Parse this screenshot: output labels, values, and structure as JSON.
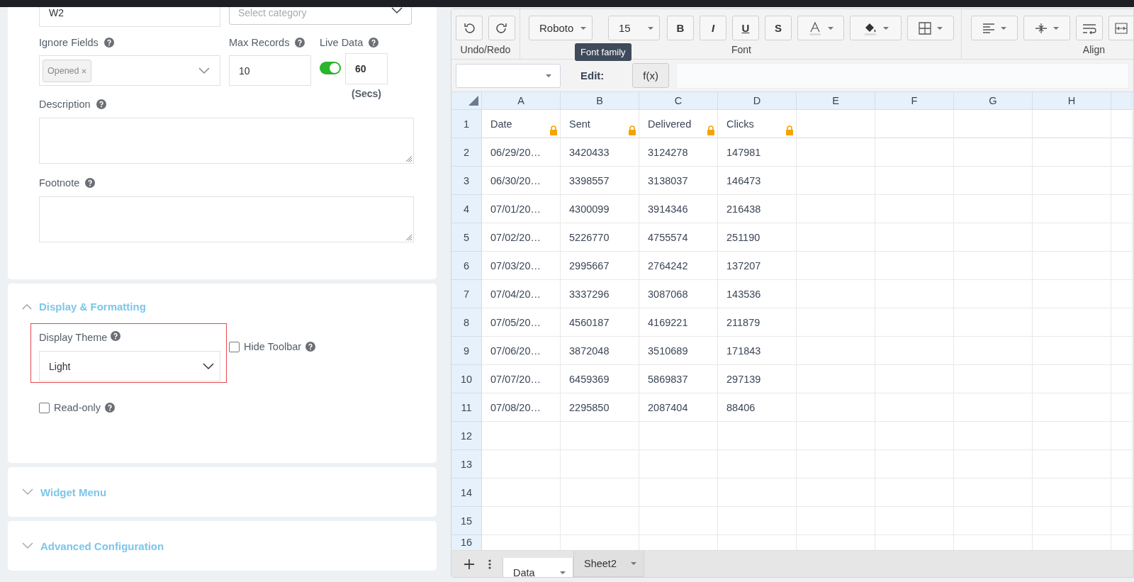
{
  "form": {
    "name_value": "W2",
    "category_placeholder": "Select category",
    "ignore_fields": {
      "label": "Ignore Fields",
      "tags": [
        "Opened"
      ]
    },
    "max_records": {
      "label": "Max Records",
      "value": "10"
    },
    "live_data": {
      "label": "Live Data",
      "on": true,
      "interval": "60",
      "unit": "(Secs)"
    },
    "description": {
      "label": "Description"
    },
    "footnote": {
      "label": "Footnote"
    }
  },
  "sections": [
    {
      "title": "Display & Formatting",
      "expanded": true,
      "theme": {
        "label": "Display Theme",
        "value": "Light",
        "highlighted": true
      },
      "options": [
        {
          "label": "Hide Toolbar",
          "checked": false
        },
        {
          "label": "Read-only",
          "checked": false
        }
      ]
    },
    {
      "title": "Widget Menu",
      "expanded": false
    },
    {
      "title": "Advanced Configuration",
      "expanded": false
    }
  ],
  "sheet": {
    "toolbar": {
      "undo_label": "Undo/Redo",
      "font_label": "Font",
      "align_label": "Align",
      "font_family": "Roboto",
      "font_size": "15",
      "styles": [
        "B",
        "I",
        "U",
        "S"
      ],
      "tooltip": "Font family"
    },
    "formula": {
      "label": "Edit:",
      "fx": "f(x)"
    },
    "columns": [
      "A",
      "B",
      "C",
      "D",
      "E",
      "F",
      "G",
      "H"
    ],
    "rows": [
      {
        "number": "1",
        "locked": true,
        "cells": [
          "Date",
          "Sent",
          "Delivered",
          "Clicks"
        ]
      },
      {
        "number": "2",
        "locked": false,
        "cells": [
          "06/29/20…",
          "3420433",
          "3124278",
          "147981"
        ]
      },
      {
        "number": "3",
        "locked": false,
        "cells": [
          "06/30/20…",
          "3398557",
          "3138037",
          "146473"
        ]
      },
      {
        "number": "4",
        "locked": false,
        "cells": [
          "07/01/20…",
          "4300099",
          "3914346",
          "216438"
        ]
      },
      {
        "number": "5",
        "locked": false,
        "cells": [
          "07/02/20…",
          "5226770",
          "4755574",
          "251190"
        ]
      },
      {
        "number": "6",
        "locked": false,
        "cells": [
          "07/03/20…",
          "2995667",
          "2764242",
          "137207"
        ]
      },
      {
        "number": "7",
        "locked": false,
        "cells": [
          "07/04/20…",
          "3337296",
          "3087068",
          "143536"
        ]
      },
      {
        "number": "8",
        "locked": false,
        "cells": [
          "07/05/20…",
          "4560187",
          "4169221",
          "211879"
        ]
      },
      {
        "number": "9",
        "locked": false,
        "cells": [
          "07/06/20…",
          "3872048",
          "3510689",
          "171843"
        ]
      },
      {
        "number": "10",
        "locked": false,
        "cells": [
          "07/07/20…",
          "6459369",
          "5869837",
          "297139"
        ]
      },
      {
        "number": "11",
        "locked": false,
        "cells": [
          "07/08/20…",
          "2295850",
          "2087404",
          "88406"
        ]
      },
      {
        "number": "12",
        "locked": false
      },
      {
        "number": "13",
        "locked": false
      },
      {
        "number": "14",
        "locked": false
      },
      {
        "number": "15",
        "locked": false
      },
      {
        "number": "16",
        "locked": false
      }
    ],
    "tabs": [
      {
        "label": "Data",
        "selected": true
      },
      {
        "label": "Sheet2",
        "selected": false
      }
    ]
  }
}
